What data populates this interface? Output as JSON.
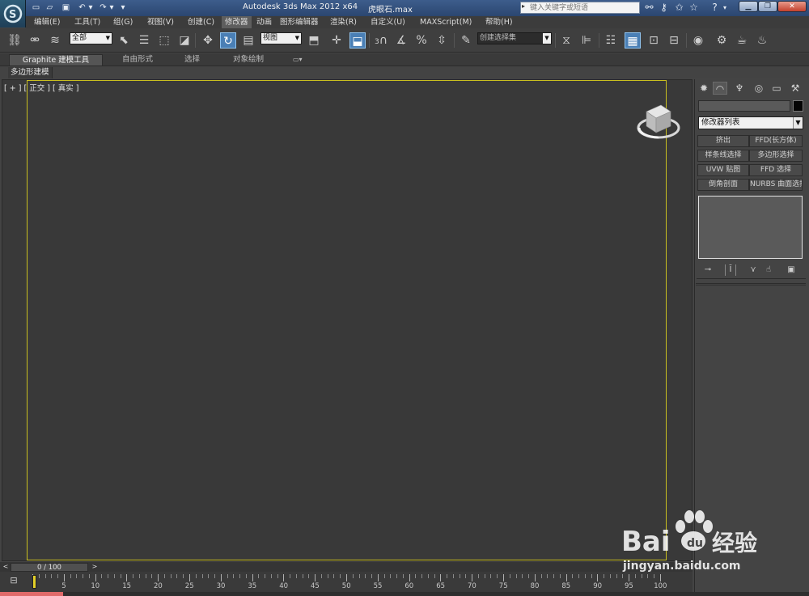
{
  "titlebar": {
    "app_title": "Autodesk 3ds Max  2012 x64",
    "file_name": "虎眼石.max",
    "search_placeholder": "键入关键字或短语",
    "quick_access": [
      "new-file-icon",
      "open-file-icon",
      "save-icon",
      "undo-icon",
      "undo-dropdown-icon",
      "redo-icon",
      "redo-dropdown-icon",
      "customize-dropdown-icon"
    ],
    "info_icons": [
      "binoculars-icon",
      "key-icon",
      "favorites-star-icon",
      "star-icon",
      "help-icon"
    ],
    "window_buttons": [
      "minimize",
      "restore",
      "close"
    ]
  },
  "menubar": {
    "items": [
      "编辑(E)",
      "工具(T)",
      "组(G)",
      "视图(V)",
      "创建(C)",
      "修改器",
      "动画",
      "图形编辑器",
      "渲染(R)",
      "自定义(U)",
      "MAXScript(M)",
      "帮助(H)"
    ],
    "active": "修改器"
  },
  "toolbar": {
    "selection_filter": "全部",
    "reference_coord": "视图",
    "named_selection": "创建选择集",
    "active_tool": "rotate"
  },
  "ribbon": {
    "tabs": [
      "Graphite 建模工具",
      "自由形式",
      "选择",
      "对象绘制"
    ],
    "active_tab": "Graphite 建模工具",
    "sub_panel": "多边形建模"
  },
  "viewport": {
    "label": "[ + ] [ 正交 ] [ 真实 ]",
    "label_parts": [
      "+",
      "正交",
      "真实"
    ],
    "safe_frame_color": "#c9bf1f"
  },
  "command_panel": {
    "tabs": [
      "create-icon",
      "modify-icon",
      "hierarchy-icon",
      "motion-icon",
      "display-icon",
      "utilities-icon"
    ],
    "active_tab": "modify-icon",
    "object_name": "",
    "object_color": "#050505",
    "modifier_list": "修改器列表",
    "modifier_buttons": [
      [
        "挤出",
        "FFD(长方体)"
      ],
      [
        "样条线选择",
        "多边形选择"
      ],
      [
        "UVW 贴图",
        "FFD 选择"
      ],
      [
        "倒角剖面",
        "NURBS 曲面选择"
      ]
    ],
    "stack_tools": [
      "pin-stack-icon",
      "show-end-result-icon",
      "make-unique-icon",
      "remove-modifier-icon",
      "configure-sets-icon"
    ]
  },
  "timeline": {
    "frame_indicator": "0 / 100",
    "ticks_start": 0,
    "ticks_end": 100,
    "labels": [
      "5",
      "10",
      "15",
      "20",
      "25",
      "30",
      "35",
      "40",
      "45",
      "50",
      "55",
      "60",
      "65",
      "70",
      "75",
      "80",
      "85",
      "90",
      "95",
      "100"
    ]
  },
  "watermark": {
    "brand": "Bai",
    "brand_suffix": "经验",
    "url": "jingyan.baidu.com"
  }
}
